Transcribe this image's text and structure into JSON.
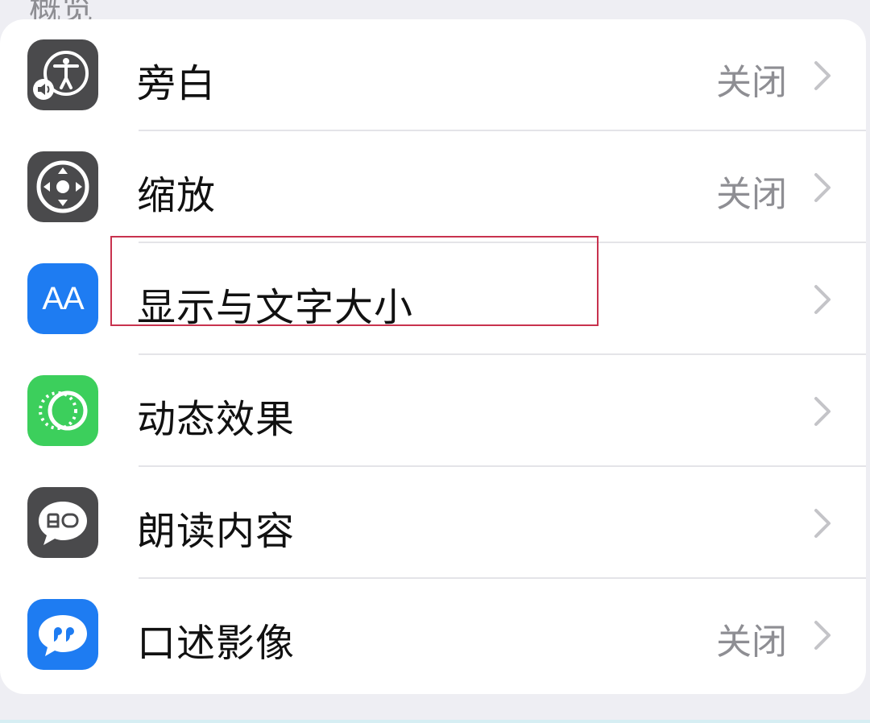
{
  "section": {
    "header_partial": "概览"
  },
  "rows": [
    {
      "label": "旁白",
      "value": "关闭",
      "icon": "voiceover-icon",
      "icon_bg": "#4a4a4c"
    },
    {
      "label": "缩放",
      "value": "关闭",
      "icon": "zoom-icon",
      "icon_bg": "#4a4a4c"
    },
    {
      "label": "显示与文字大小",
      "value": "",
      "icon": "text-size-icon",
      "icon_bg": "#1e7cf2",
      "icon_text": "AA"
    },
    {
      "label": "动态效果",
      "value": "",
      "icon": "motion-icon",
      "icon_bg": "#3ccf5c"
    },
    {
      "label": "朗读内容",
      "value": "",
      "icon": "spoken-content-icon",
      "icon_bg": "#4a4a4c"
    },
    {
      "label": "口述影像",
      "value": "关闭",
      "icon": "audio-descriptions-icon",
      "icon_bg": "#1e7cf2"
    }
  ],
  "highlight_color": "#c8324e"
}
